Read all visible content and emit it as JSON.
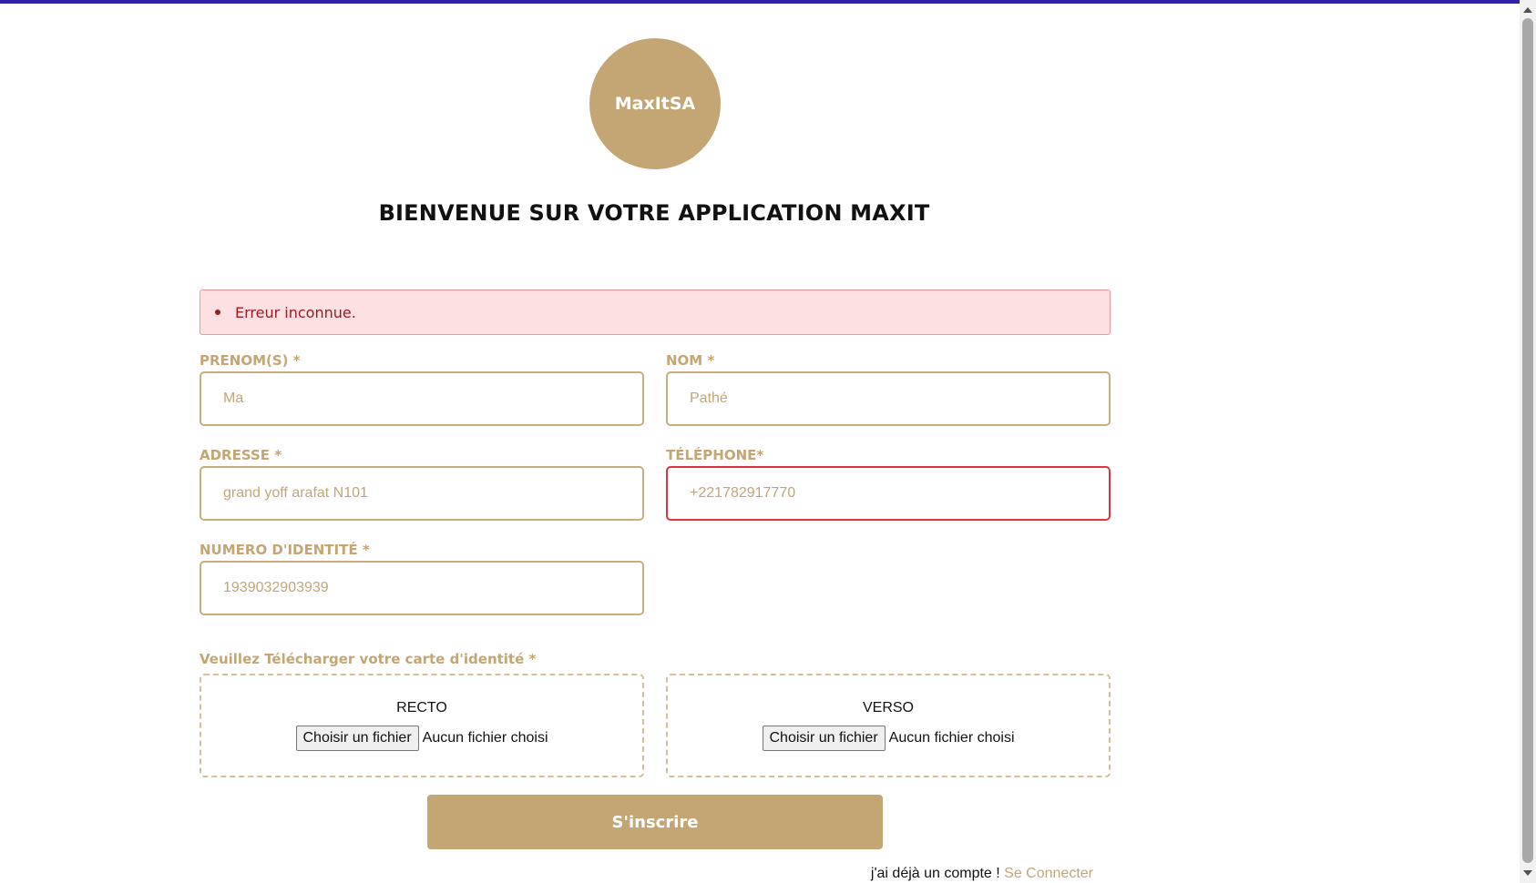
{
  "app": {
    "logo_text": "MaxItSA",
    "title": "BIENVENUE SUR VOTRE APPLICATION MAXIT"
  },
  "alert": {
    "message": "Erreur inconnue."
  },
  "form": {
    "prenom": {
      "label": "PRENOM(S) *",
      "value": "Ma"
    },
    "nom": {
      "label": "NOM *",
      "value": "Pathé"
    },
    "adresse": {
      "label": "ADRESSE *",
      "value": "grand yoff arafat N101"
    },
    "telephone": {
      "label": "TÉLÉPHONE*",
      "value": "+221782917770"
    },
    "numero_identite": {
      "label": "NUMERO D'IDENTITÉ *",
      "value": "1939032903939"
    },
    "upload_label": "Veuillez Télécharger votre carte d'identité *",
    "recto": {
      "title": "RECTO",
      "button": "Choisir un fichier",
      "status": "Aucun fichier choisi"
    },
    "verso": {
      "title": "VERSO",
      "button": "Choisir un fichier",
      "status": "Aucun fichier choisi"
    },
    "submit_label": "S'inscrire"
  },
  "footer": {
    "prompt": "j'ai déjà un compte ! ",
    "link": "Se Connecter"
  },
  "colors": {
    "accent": "#c4a574",
    "error_border": "#e0323c",
    "alert_bg": "#fde0e2",
    "top_bar": "#2e22a8"
  }
}
